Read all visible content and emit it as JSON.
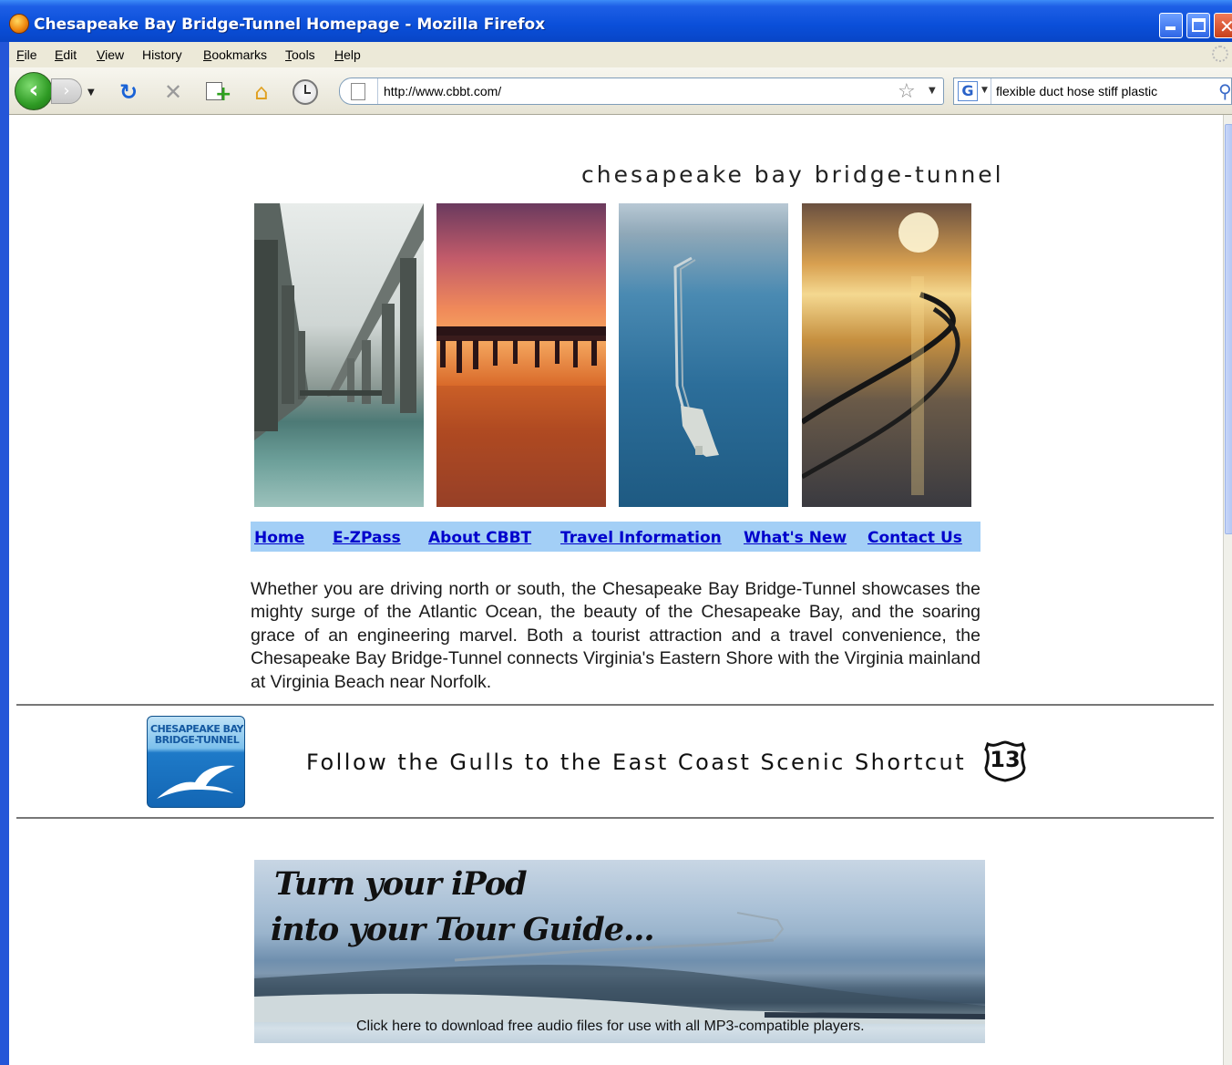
{
  "window": {
    "title": "Chesapeake Bay Bridge-Tunnel Homepage - Mozilla Firefox",
    "icon": "firefox-icon"
  },
  "menubar": {
    "items": [
      {
        "key": "F",
        "rest": "ile"
      },
      {
        "key": "E",
        "rest": "dit"
      },
      {
        "key": "V",
        "rest": "iew"
      },
      {
        "key": "Hi",
        "rest": "story"
      },
      {
        "key": "B",
        "rest": "ookmarks"
      },
      {
        "key": "T",
        "rest": "ools"
      },
      {
        "key": "H",
        "rest": "elp"
      }
    ]
  },
  "navbar": {
    "url": "http://www.cbbt.com/",
    "search_engine": "G",
    "search_value": "flexible duct hose stiff plastic"
  },
  "page": {
    "site_title": "chesapeake bay bridge-tunnel",
    "nav": [
      "Home",
      "E-ZPass",
      "About CBBT",
      "Travel Information",
      "What's New",
      "Contact Us"
    ],
    "intro": "Whether you are driving north or south, the Chesapeake Bay Bridge-Tunnel showcases the mighty surge of the Atlantic Ocean, the beauty of the Chesapeake Bay, and the soaring grace of an engineering marvel.  Both a tourist attraction and a travel convenience, the Chesapeake Bay Bridge-Tunnel connects Virginia's Eastern Shore with the Virginia mainland at Virginia Beach near Norfolk.",
    "logo_text_1": "CHESAPEAKE BAY",
    "logo_text_2": "BRIDGE-TUNNEL",
    "tagline": "Follow the Gulls to the East Coast Scenic Shortcut",
    "route_number": "13",
    "banner_line1": "Turn your iPod",
    "banner_line2": "into your Tour Guide...",
    "banner_caption": "Click here to download free audio files for use with all MP3-compatible players."
  },
  "colors": {
    "link": "#0000cc",
    "nav_strip": "#a3cff6",
    "titlebar": "#0a4fd9"
  }
}
